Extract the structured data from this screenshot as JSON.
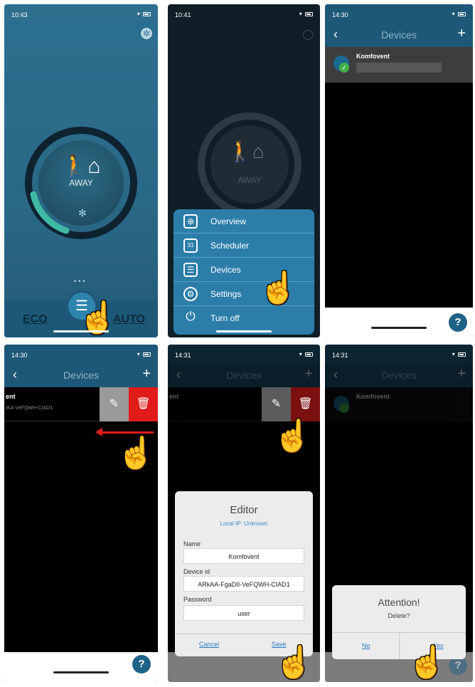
{
  "panel1": {
    "time": "10:43",
    "mode_label": "AWAY",
    "eco_label": "ECO",
    "auto_label": "AUTO"
  },
  "panel2": {
    "time": "10:41",
    "mode_label": "AWAY",
    "menu": [
      {
        "label": "Overview",
        "icon": "overview-icon",
        "glyph": "⊕"
      },
      {
        "label": "Scheduler",
        "icon": "calendar-icon",
        "glyph": "31"
      },
      {
        "label": "Devices",
        "icon": "devices-list-icon",
        "glyph": "☰"
      },
      {
        "label": "Settings",
        "icon": "gear-icon",
        "glyph": "⚙"
      },
      {
        "label": "Turn off",
        "icon": "power-icon",
        "glyph": "⏻"
      }
    ]
  },
  "panel3": {
    "time": "14:30",
    "nav_title": "Devices",
    "device_name": "Komfovent"
  },
  "panel4": {
    "time": "14:30",
    "nav_title": "Devices",
    "device_name": "ent",
    "device_sub": "IKA-VeFQWH-CIAD1"
  },
  "panel5": {
    "time": "14:31",
    "nav_title": "Devices",
    "device_name": "ent",
    "dialog": {
      "title": "Editor",
      "subtitle": "Local IP: Unknown",
      "name_label": "Name",
      "name_value": "Komfovent",
      "device_id_label": "Device id",
      "device_id_value": "ARkAA-FgaDII-VeFQWH-CIAD1",
      "password_label": "Password",
      "password_value": "user",
      "cancel": "Cancel",
      "save": "Save"
    }
  },
  "panel6": {
    "time": "14:31",
    "nav_title": "Devices",
    "device_name": "Komfovent",
    "alert": {
      "title": "Attention!",
      "message": "Delete?",
      "no": "No",
      "yes": "Yes"
    }
  },
  "help_label": "?",
  "colors": {
    "accent": "#2c7ea9",
    "danger": "#e11a1a",
    "nav": "#1d5878"
  }
}
